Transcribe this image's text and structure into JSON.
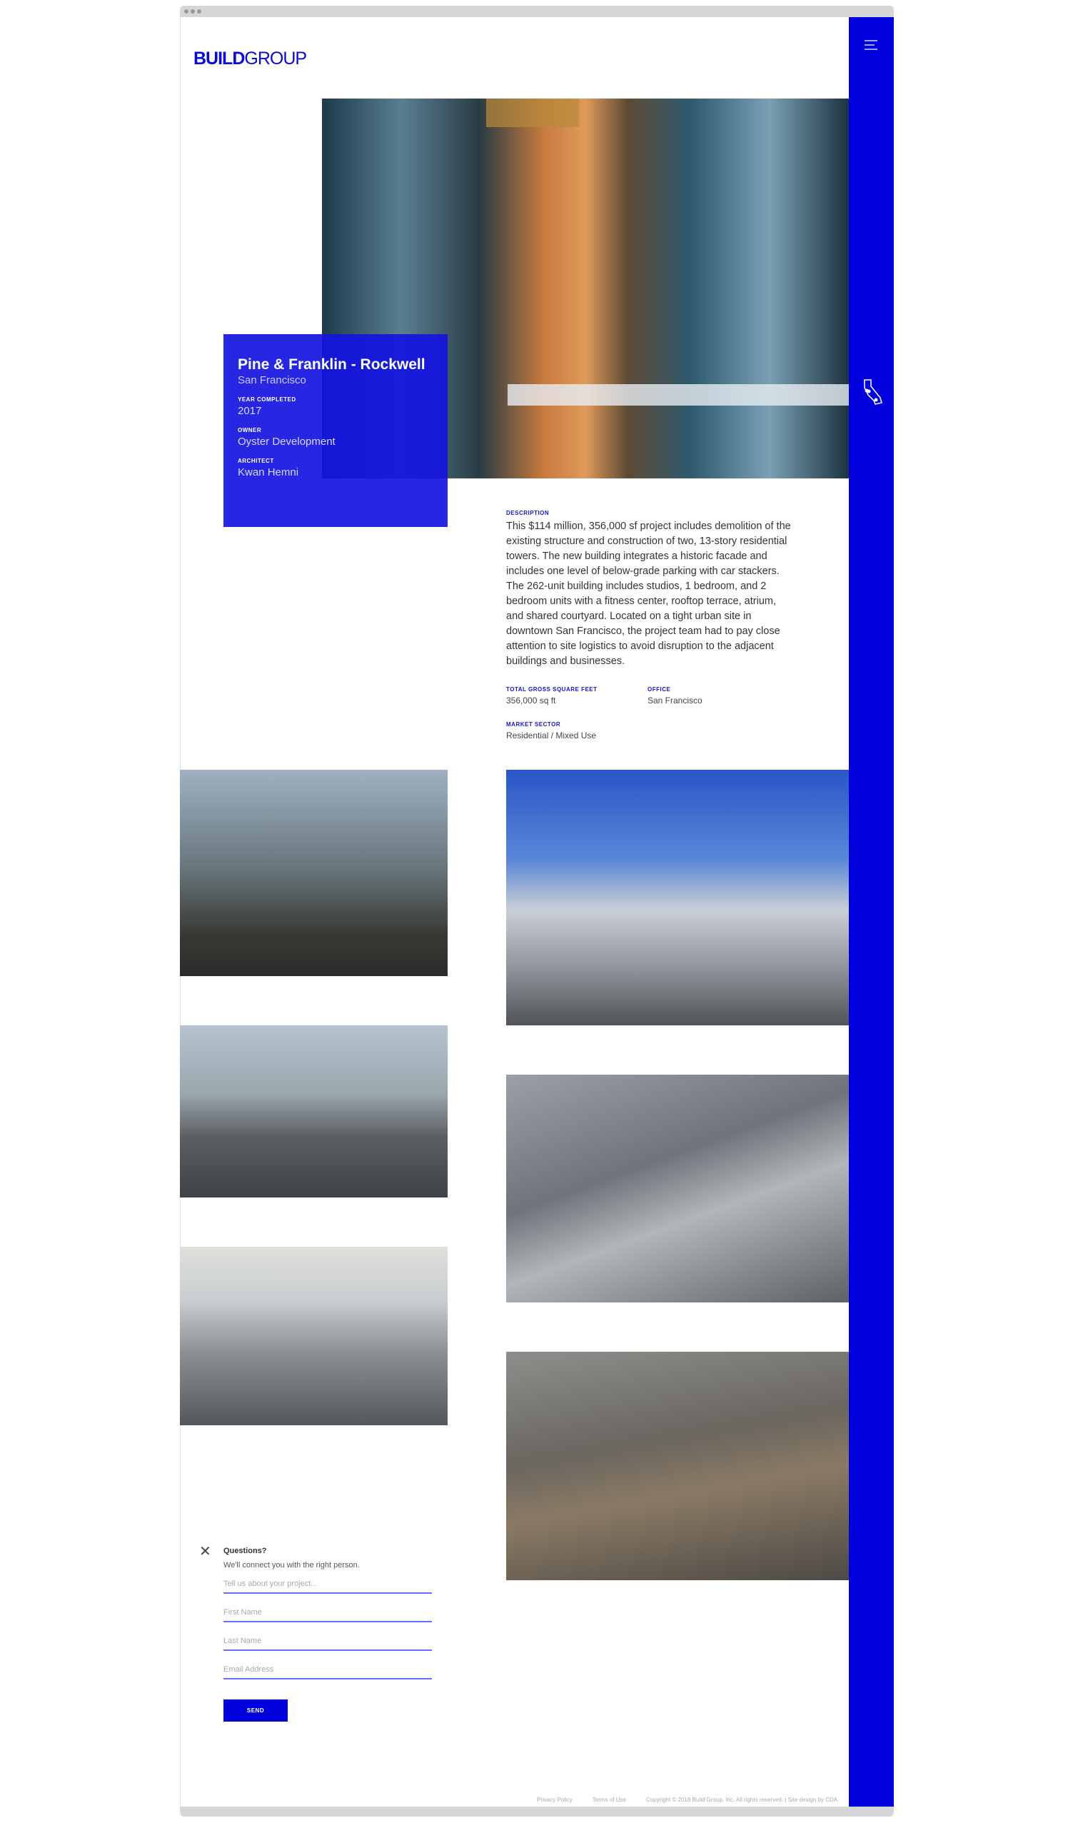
{
  "brand": {
    "logo_bold": "BUILD",
    "logo_light": "GROUP",
    "accent": "#0000dc"
  },
  "sidebar": {
    "menu_icon": "hamburger-icon",
    "map_icon": "california-map-icon"
  },
  "project": {
    "title": "Pine & Franklin - Rockwell",
    "city": "San Francisco",
    "year_label": "YEAR COMPLETED",
    "year": "2017",
    "owner_label": "OWNER",
    "owner": "Oyster Development",
    "architect_label": "ARCHITECT",
    "architect": "Kwan Hemni"
  },
  "details": {
    "description_label": "DESCRIPTION",
    "description": "This $114 million, 356,000 sf project includes demolition of the existing structure and construction of two, 13-story residential towers. The new building integrates a historic facade and includes one level of below-grade parking with car stackers. The 262-unit building includes studios, 1 bedroom, and 2 bedroom units with a fitness center, rooftop terrace, atrium, and shared courtyard. Located on a tight urban site in downtown San Francisco, the project team had to pay close attention to site logistics to avoid disruption to the adjacent buildings and businesses.",
    "sqft_label": "TOTAL GROSS SQUARE FEET",
    "sqft": "356,000 sq ft",
    "office_label": "OFFICE",
    "office": "San Francisco",
    "sector_label": "MARKET SECTOR",
    "sector": "Residential / Mixed Use"
  },
  "form": {
    "title": "Questions?",
    "subtitle": "We'll connect you with the right person.",
    "project_placeholder": "Tell us about your project...",
    "first_placeholder": "First Name",
    "last_placeholder": "Last Name",
    "email_placeholder": "Email Address",
    "send": "SEND"
  },
  "footer": {
    "privacy": "Privacy Policy",
    "terms": "Terms of Use",
    "copyright": "Copyright © 2018 Build Group, Inc. All rights reserved. | Site design by CDA"
  }
}
